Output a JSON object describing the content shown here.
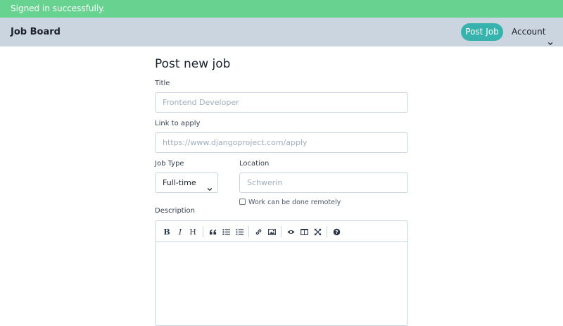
{
  "flash": {
    "message": "Signed in successfully."
  },
  "navbar": {
    "brand": "Job Board",
    "post_job_label": "Post Job",
    "account_label": "Account"
  },
  "form": {
    "title": "Post new job",
    "title_field": {
      "label": "Title",
      "placeholder": "Frontend Developer"
    },
    "link_field": {
      "label": "Link to apply",
      "placeholder": "https://www.djangoproject.com/apply"
    },
    "job_type_field": {
      "label": "Job Type",
      "selected": "Full-time"
    },
    "location_field": {
      "label": "Location",
      "placeholder": "Schwerin"
    },
    "remote_checkbox": {
      "label": "Work can be done remotely",
      "checked": false
    },
    "description_field": {
      "label": "Description",
      "toolbar": [
        "bold-icon",
        "italic-icon",
        "heading-icon",
        "quote-icon",
        "unordered-list-icon",
        "ordered-list-icon",
        "link-icon",
        "image-icon",
        "preview-icon",
        "side-by-side-icon",
        "fullscreen-icon",
        "guide-icon"
      ]
    }
  },
  "colors": {
    "flash_bg": "#68d391",
    "navbar_bg": "#cbd5e0",
    "accent": "#38b2ac"
  }
}
